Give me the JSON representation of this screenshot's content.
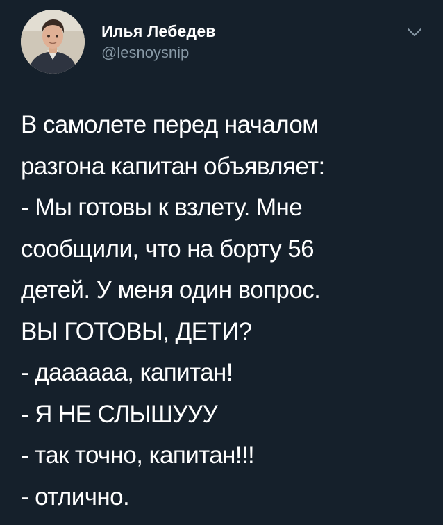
{
  "author": {
    "display_name": "Илья Лебедев",
    "handle": "@lesnoysnip",
    "avatar_icon": "user-avatar-photo"
  },
  "caret_icon": "chevron-down-icon",
  "tweet": {
    "lines": [
      "В самолете перед началом",
      "разгона капитан объявляет:",
      "- Мы готовы к взлету. Мне",
      "сообщили, что на борту 56",
      "детей. У меня один вопрос.",
      "ВЫ ГОТОВЫ, ДЕТИ?",
      "- даааааа, капитан!",
      "- Я НЕ СЛЫШУУУ",
      "- так точно, капитан!!!",
      "- отлично."
    ]
  },
  "colors": {
    "background": "#15202b",
    "text": "#ffffff",
    "secondary_text": "#8899a6"
  }
}
